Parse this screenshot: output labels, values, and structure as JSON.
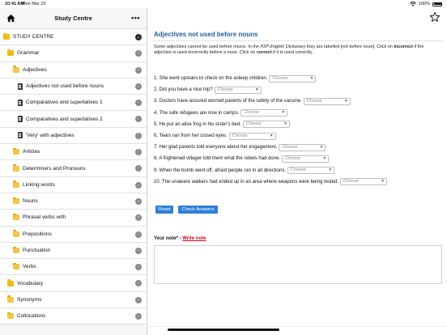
{
  "status_bar": {
    "time": "10:41 AM",
    "date": "Mon Mar 23",
    "battery": "100%"
  },
  "sidebar": {
    "title": "Study Centre",
    "items": [
      {
        "label": "STUDY CENTRE",
        "level": 0,
        "icon": "folder-icon"
      },
      {
        "label": "Grammar",
        "level": 1,
        "icon": "folder-icon"
      },
      {
        "label": "Adjectives",
        "level": 2,
        "icon": "open-folder-icon"
      },
      {
        "label": "Adjectives not used before nouns",
        "level": 3,
        "icon": "document-icon"
      },
      {
        "label": "Comparatives and superlatives 1",
        "level": 3,
        "icon": "document-icon"
      },
      {
        "label": "Comparatives and superlatives 2",
        "level": 3,
        "icon": "document-icon"
      },
      {
        "label": "'Very' with adjectives",
        "level": 3,
        "icon": "document-icon"
      },
      {
        "label": "Articles",
        "level": 2,
        "icon": "open-folder-icon"
      },
      {
        "label": "Determiners and Pronouns",
        "level": 2,
        "icon": "open-folder-icon"
      },
      {
        "label": "Linking words",
        "level": 2,
        "icon": "open-folder-icon"
      },
      {
        "label": "Nouns",
        "level": 2,
        "icon": "open-folder-icon"
      },
      {
        "label": "Phrasal verbs with",
        "level": 2,
        "icon": "open-folder-icon"
      },
      {
        "label": "Prepositions",
        "level": 2,
        "icon": "open-folder-icon"
      },
      {
        "label": "Punctuation",
        "level": 2,
        "icon": "open-folder-icon"
      },
      {
        "label": "Verbs",
        "level": 2,
        "icon": "open-folder-icon"
      },
      {
        "label": "Vocabulary",
        "level": 1,
        "icon": "folder-icon"
      },
      {
        "label": "Synonyms",
        "level": 1,
        "icon": "open-folder-icon"
      },
      {
        "label": "Collocations",
        "level": 1,
        "icon": "open-folder-icon"
      }
    ]
  },
  "lesson": {
    "title": "Adjectives not used before nouns",
    "instructions": {
      "part1": "Some adjectives cannot be used before nouns. In the ",
      "dictionary": "P2P English Dictionary",
      "part2": " they are labelled [not before noun]. Click on ",
      "incorrect": "incorrect",
      "part3": " if the adjective is used incorrectly before a noun. Click on ",
      "correct": "correct",
      "part4": " if it is used correctly."
    },
    "select_placeholder": "Choose",
    "questions": [
      "1. She went upstairs to check on the asleep children.",
      "2. Did you have a nice trip?",
      "3. Doctors have assured worried parents of the safety of the vaccine.",
      "4. The safe refugees are now in camps.",
      "5. He put an alive frog in his sister's bed.",
      "6. Tears ran from her closed eyes.",
      "7. Her glad parents told everyone about her engagement.",
      "8. A frightened villager told them what the rebels had done.",
      "9. When the bomb went off, afraid people ran in all directions.",
      "10. The unaware walkers had ended up in an area where weapons were being tested."
    ],
    "reset_label": "Reset",
    "check_label": "Check Answers",
    "note_label": "Your note* - ",
    "note_link": "Write note"
  }
}
